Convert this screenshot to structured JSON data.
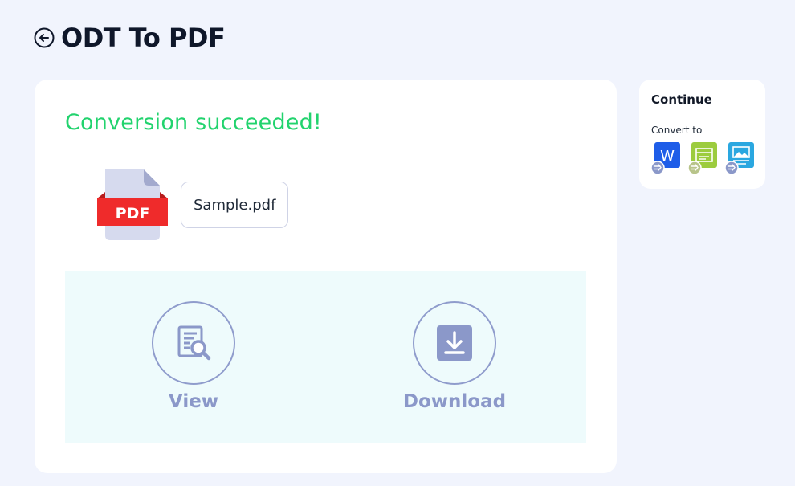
{
  "header": {
    "title": "ODT To PDF",
    "back_icon": "arrow-left-circle-icon"
  },
  "main": {
    "status": "Conversion succeeded!",
    "status_color": "#22d36e",
    "file": {
      "icon": "pdf-file-icon",
      "badge": "PDF",
      "name": "Sample.pdf"
    },
    "actions": {
      "view": {
        "label": "View",
        "icon": "document-search-icon"
      },
      "download": {
        "label": "Download",
        "icon": "download-icon"
      }
    }
  },
  "side": {
    "title": "Continue",
    "subtitle": "Convert to",
    "targets": [
      {
        "icon": "word-convert-icon",
        "glyph": "W",
        "color": "#1e5de8"
      },
      {
        "icon": "spreadsheet-convert-icon",
        "color": "#9ccc3e"
      },
      {
        "icon": "image-convert-icon",
        "color": "#2aa7e0"
      }
    ]
  },
  "colors": {
    "background": "#f1f4fd",
    "accent_muted": "#8b98c9",
    "pdf_red": "#ef2b2b"
  }
}
